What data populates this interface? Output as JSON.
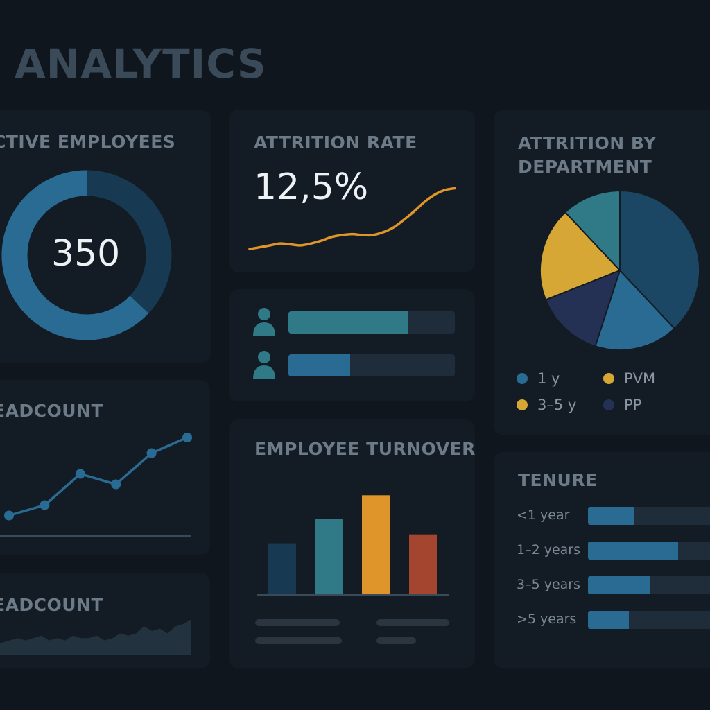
{
  "page": {
    "title": "R ANALYTICS"
  },
  "colors": {
    "background": "#0f161d",
    "card": "#131c24",
    "blue": "#2a6b94",
    "teal": "#2f7a86",
    "gold": "#d7a735",
    "navy": "#253154",
    "orange": "#e0952a",
    "rust": "#a3452f",
    "dark_blue": "#173a52"
  },
  "active_employees": {
    "title": "CTIVE EMPLOYEES",
    "value": "350",
    "fill_fraction": 0.63
  },
  "attrition_rate": {
    "title": "ATTRITION RATE",
    "value": "12,5%"
  },
  "comparison_bars": {
    "items": [
      {
        "icon": "person-icon",
        "fill_fraction": 0.72
      },
      {
        "icon": "person-icon",
        "fill_fraction": 0.37
      }
    ]
  },
  "attrition_by_department": {
    "title_line1": "ATTRITION BY",
    "title_line2": "DEPARTMENT",
    "legend": [
      {
        "label": "1 y",
        "color": "#2a6b94"
      },
      {
        "label": "PVM",
        "color": "#d7a735"
      },
      {
        "label": "3–5 y",
        "color": "#d7a735"
      },
      {
        "label": "PP",
        "color": "#253154"
      }
    ]
  },
  "headcount_line": {
    "title": "EADCOUNT"
  },
  "headcount_area": {
    "title": "EADCOUNT"
  },
  "employee_turnover": {
    "title": "EMPLOYEE TURNOVER"
  },
  "tenure": {
    "title": "TENURE",
    "rows": [
      {
        "label": "<1 year",
        "fill_fraction": 0.37
      },
      {
        "label": "1–2 years",
        "fill_fraction": 0.72
      },
      {
        "label": "3–5 years",
        "fill_fraction": 0.5
      },
      {
        "label": ">5 years",
        "fill_fraction": 0.33
      }
    ]
  },
  "chart_data": [
    {
      "type": "line",
      "x": [
        0,
        1,
        2,
        3,
        4,
        5,
        6,
        7,
        8,
        9,
        10,
        11,
        12,
        13,
        14,
        15,
        16,
        17,
        18,
        19,
        20
      ],
      "series": [
        {
          "values": [
            5,
            7,
            9,
            11,
            10,
            9,
            11,
            14,
            18,
            20,
            21,
            20,
            20,
            23,
            28,
            36,
            45,
            55,
            63,
            68,
            70
          ]
        }
      ],
      "ylim": [
        0,
        80
      ]
    },
    {
      "type": "line",
      "x": [
        1,
        2,
        3,
        4,
        5,
        6
      ],
      "series": [
        {
          "values": [
            3,
            5,
            11,
            9,
            15,
            18
          ]
        }
      ],
      "ylim": [
        0,
        20
      ]
    },
    {
      "type": "area",
      "x": [
        0,
        1,
        2,
        3,
        4,
        5,
        6,
        7,
        8,
        9,
        10,
        11,
        12,
        13,
        14,
        15,
        16,
        17,
        18,
        19,
        20,
        21,
        22,
        23,
        24,
        25,
        26
      ],
      "series": [
        {
          "values": [
            4,
            5,
            5,
            6,
            7,
            6,
            7,
            8,
            6,
            7,
            6,
            8,
            7,
            7,
            8,
            6,
            7,
            9,
            8,
            9,
            12,
            10,
            11,
            9,
            12,
            13,
            15
          ]
        }
      ],
      "ylim": [
        0,
        20
      ]
    },
    {
      "type": "pie",
      "slices": [
        {
          "value": 38,
          "color": "#1c4764"
        },
        {
          "value": 17,
          "color": "#2a6b94"
        },
        {
          "value": 14,
          "color": "#253154"
        },
        {
          "value": 19,
          "color": "#d7a735"
        },
        {
          "value": 12,
          "color": "#2f7a86"
        }
      ]
    },
    {
      "type": "bar",
      "values": [
        4.5,
        6.7,
        8.8,
        5.3
      ],
      "colors": [
        "#173a52",
        "#2f7a86",
        "#e0952a",
        "#a3452f"
      ],
      "ylim": [
        0,
        10
      ]
    }
  ]
}
